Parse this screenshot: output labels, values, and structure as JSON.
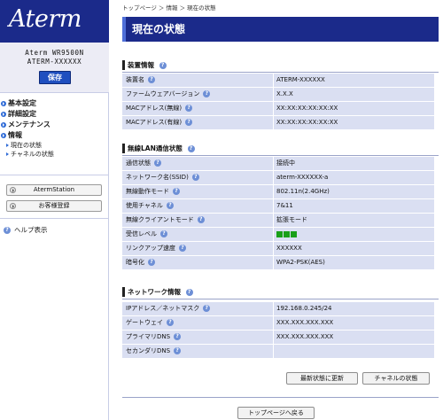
{
  "sidebar": {
    "logo": "Aterm",
    "model_line1": "Aterm WR9500N",
    "model_line2": "ATERM-XXXXXX",
    "save_label": "保存",
    "nav": {
      "basic": "基本設定",
      "advanced": "詳細設定",
      "maintenance": "メンテナンス",
      "info": "情報",
      "sub_status": "現在の状態",
      "sub_channel": "チャネルの状態"
    },
    "aterm_station_label": "AtermStation",
    "register_label": "お客様登録",
    "help_label": "ヘルプ表示"
  },
  "breadcrumb": "トップページ ＞ 情報 ＞ 現在の状態",
  "page_title": "現在の状態",
  "help_glyph": "?",
  "device_info": {
    "heading": "装置情報",
    "rows": [
      {
        "label": "装置名",
        "value": "ATERM-XXXXXX"
      },
      {
        "label": "ファームウェアバージョン",
        "value": "X.X.X"
      },
      {
        "label": "MACアドレス(無線)",
        "value": "XX:XX:XX:XX:XX:XX"
      },
      {
        "label": "MACアドレス(有線)",
        "value": "XX:XX:XX:XX:XX:XX"
      }
    ]
  },
  "wlan_status": {
    "heading": "無線LAN通信状態",
    "rows": [
      {
        "label": "通信状態",
        "value": "接続中"
      },
      {
        "label": "ネットワーク名(SSID)",
        "value": "aterm-XXXXXX-a"
      },
      {
        "label": "無線動作モード",
        "value": "802.11n(2.4GHz)"
      },
      {
        "label": "使用チャネル",
        "value": "7&11"
      },
      {
        "label": "無線クライアントモード",
        "value": "拡張モード"
      },
      {
        "label": "受信レベル",
        "value": ""
      },
      {
        "label": "リンクアップ速度",
        "value": "XXXXXX"
      },
      {
        "label": "暗号化",
        "value": "WPA2-PSK(AES)"
      }
    ],
    "signal_bars": 3,
    "signal_color": "#19a019"
  },
  "network_info": {
    "heading": "ネットワーク情報",
    "rows": [
      {
        "label": "IPアドレス／ネットマスク",
        "value": "192.168.0.245/24"
      },
      {
        "label": "ゲートウェイ",
        "value": "XXX.XXX.XXX.XXX"
      },
      {
        "label": "プライマリDNS",
        "value": "XXX.XXX.XXX.XXX"
      },
      {
        "label": "セカンダリDNS",
        "value": ""
      }
    ]
  },
  "buttons": {
    "refresh": "最新状態に更新",
    "channel_status": "チャネルの状態",
    "back_to_top": "トップページへ戻る"
  },
  "colors": {
    "brand": "#1b2a8a",
    "row_bg": "#dadff2",
    "accent": "#2f6bd6"
  }
}
